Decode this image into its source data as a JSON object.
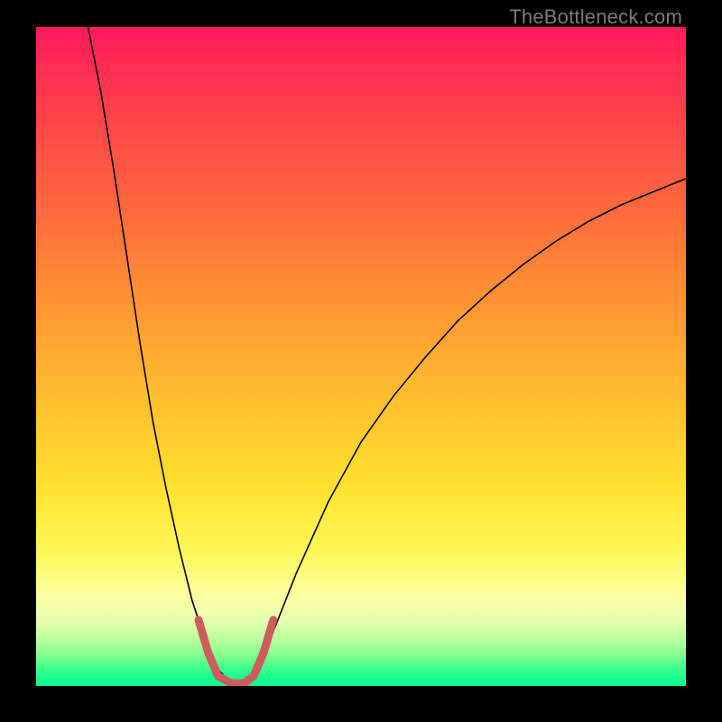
{
  "attribution": "TheBottleneck.com",
  "colors": {
    "background": "#000000",
    "curve_main": "#000000",
    "curve_bottom": "#cd5c5c",
    "gradient_top": "#ff1a5c",
    "gradient_bottom": "#0dff91"
  },
  "chart_data": {
    "type": "line",
    "title": "",
    "xlabel": "",
    "ylabel": "",
    "xlim": [
      0,
      100
    ],
    "ylim": [
      0,
      100
    ],
    "note": "No numeric axes shown; x/y are normalized percent of plot area. Curve forms a V with minimum near x≈28–33% reaching y≈0, left branch rising steeply to top-left corner, right branch rising to ~y≈77 at x=100.",
    "series": [
      {
        "name": "bottleneck-curve",
        "color": "#000000",
        "points": [
          {
            "x": 8.0,
            "y": 100.0
          },
          {
            "x": 10.0,
            "y": 90.0
          },
          {
            "x": 12.0,
            "y": 78.0
          },
          {
            "x": 14.0,
            "y": 65.0
          },
          {
            "x": 16.0,
            "y": 52.0
          },
          {
            "x": 18.0,
            "y": 40.0
          },
          {
            "x": 20.0,
            "y": 30.0
          },
          {
            "x": 22.0,
            "y": 21.0
          },
          {
            "x": 24.0,
            "y": 13.0
          },
          {
            "x": 26.0,
            "y": 7.0
          },
          {
            "x": 28.0,
            "y": 2.5
          },
          {
            "x": 30.0,
            "y": 0.5
          },
          {
            "x": 32.0,
            "y": 0.5
          },
          {
            "x": 34.0,
            "y": 2.5
          },
          {
            "x": 36.0,
            "y": 7.0
          },
          {
            "x": 40.0,
            "y": 17.0
          },
          {
            "x": 45.0,
            "y": 28.0
          },
          {
            "x": 50.0,
            "y": 37.0
          },
          {
            "x": 55.0,
            "y": 44.0
          },
          {
            "x": 60.0,
            "y": 50.0
          },
          {
            "x": 65.0,
            "y": 55.5
          },
          {
            "x": 70.0,
            "y": 60.0
          },
          {
            "x": 75.0,
            "y": 64.0
          },
          {
            "x": 80.0,
            "y": 67.5
          },
          {
            "x": 85.0,
            "y": 70.5
          },
          {
            "x": 90.0,
            "y": 73.0
          },
          {
            "x": 95.0,
            "y": 75.0
          },
          {
            "x": 100.0,
            "y": 77.0
          }
        ]
      },
      {
        "name": "bottom-highlight",
        "color": "#cd5c5c",
        "stroke_width": 9,
        "points": [
          {
            "x": 25.0,
            "y": 10.0
          },
          {
            "x": 26.5,
            "y": 5.0
          },
          {
            "x": 28.0,
            "y": 1.5
          },
          {
            "x": 30.0,
            "y": 0.4
          },
          {
            "x": 32.0,
            "y": 0.4
          },
          {
            "x": 33.5,
            "y": 1.5
          },
          {
            "x": 35.0,
            "y": 5.0
          },
          {
            "x": 36.5,
            "y": 10.0
          }
        ]
      }
    ]
  }
}
